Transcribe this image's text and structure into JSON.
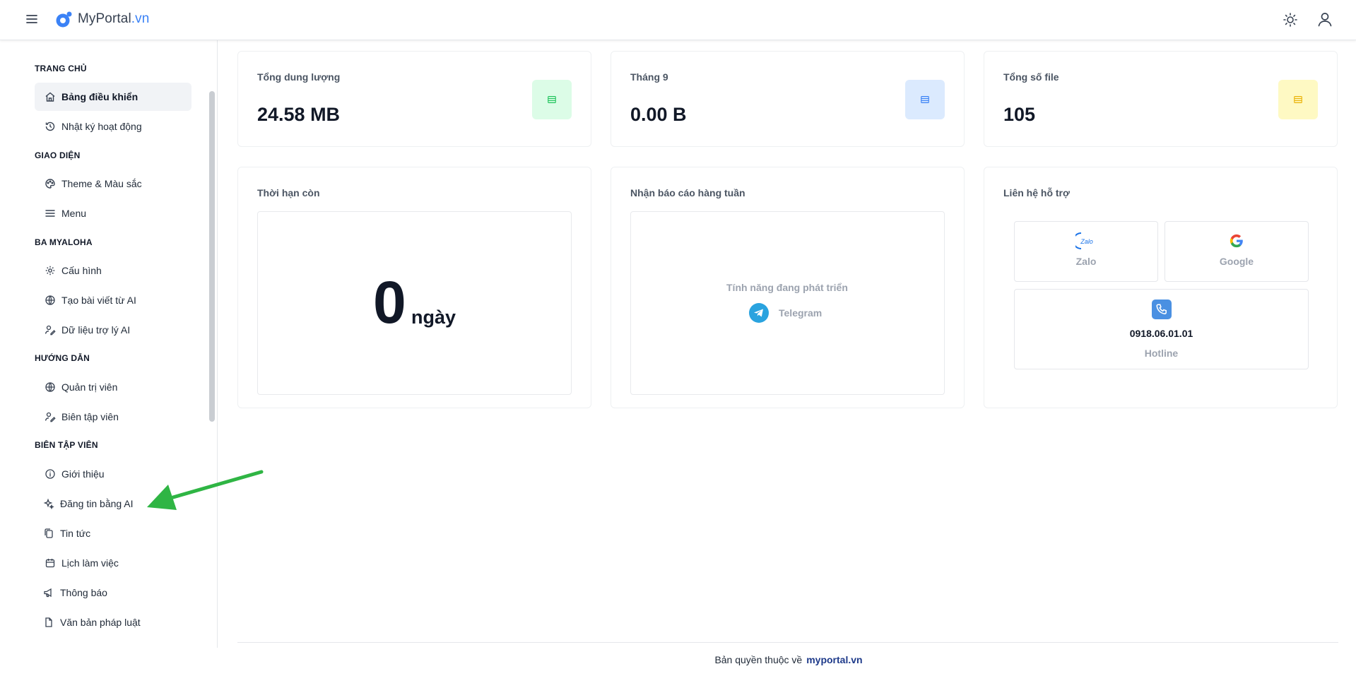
{
  "header": {
    "logo_text": "MyPortal",
    "logo_tld": ".vn"
  },
  "sidebar": {
    "sections": [
      {
        "title": "TRANG CHỦ",
        "items": [
          {
            "label": "Bảng điều khiển",
            "icon": "home-icon",
            "active": true
          },
          {
            "label": "Nhật ký hoạt động",
            "icon": "history-icon"
          }
        ]
      },
      {
        "title": "GIAO DIỆN",
        "items": [
          {
            "label": "Theme & Màu sắc",
            "icon": "palette-icon"
          },
          {
            "label": "Menu",
            "icon": "menu-lines-icon"
          }
        ]
      },
      {
        "title": "BA MYALOHA",
        "items": [
          {
            "label": "Cấu hình",
            "icon": "gear-icon"
          },
          {
            "label": "Tạo bài viết từ AI",
            "icon": "globe-icon"
          },
          {
            "label": "Dữ liệu trợ lý AI",
            "icon": "user-edit-icon"
          }
        ]
      },
      {
        "title": "HƯỚNG DẪN",
        "items": [
          {
            "label": "Quản trị viên",
            "icon": "globe-icon"
          },
          {
            "label": "Biên tập viên",
            "icon": "user-edit-icon"
          }
        ]
      },
      {
        "title": "BIÊN TẬP VIÊN",
        "items": [
          {
            "label": "Giới thiệu",
            "icon": "info-icon"
          },
          {
            "label": "Đăng tin bằng AI",
            "icon": "sparkle-icon"
          },
          {
            "label": "Tin tức",
            "icon": "copy-icon"
          },
          {
            "label": "Lịch làm việc",
            "icon": "calendar-icon"
          },
          {
            "label": "Thông báo",
            "icon": "megaphone-icon"
          },
          {
            "label": "Văn bản pháp luật",
            "icon": "file-icon"
          }
        ]
      }
    ]
  },
  "stats": [
    {
      "label": "Tổng dung lượng",
      "value": "24.58 MB",
      "icon": "database-icon",
      "color": "#22c55e",
      "bg": "#dcfce7"
    },
    {
      "label": "Tháng 9",
      "value": "0.00 B",
      "icon": "database-icon",
      "color": "#3b82f6",
      "bg": "#dbeafe"
    },
    {
      "label": "Tổng số file",
      "value": "105",
      "icon": "database-icon",
      "color": "#eab308",
      "bg": "#fef9c3"
    }
  ],
  "remaining": {
    "title": "Thời hạn còn",
    "value": "0",
    "unit": "ngày"
  },
  "weekly": {
    "title": "Nhận báo cáo hàng tuần",
    "status": "Tính năng đang phát triển",
    "channel": "Telegram"
  },
  "support": {
    "title": "Liên hệ hỗ trợ",
    "zalo": "Zalo",
    "zalo_logo": "Zalo",
    "google": "Google",
    "hotline_number": "0918.06.01.01",
    "hotline_label": "Hotline"
  },
  "footer": {
    "text": "Bản quyền thuộc về",
    "link": "myportal.vn"
  }
}
